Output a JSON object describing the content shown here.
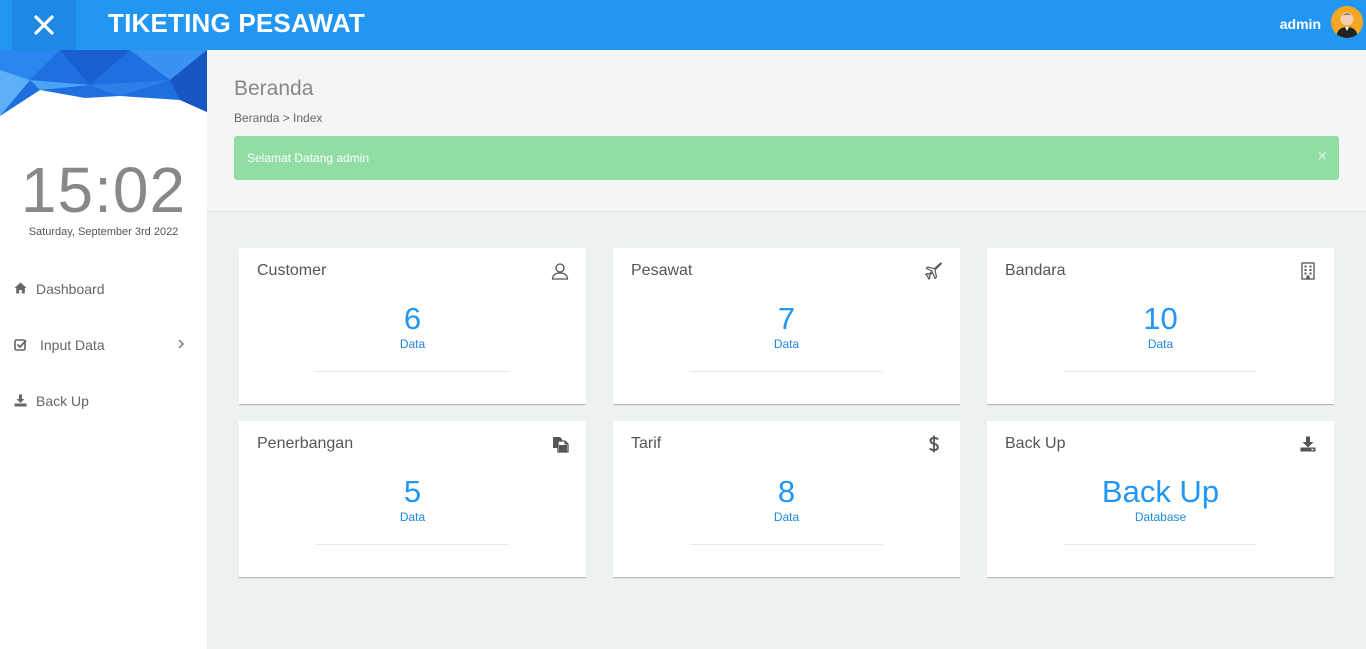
{
  "app": {
    "title": "TIKETING PESAWAT",
    "user": "admin"
  },
  "sidebar": {
    "time": "15:02",
    "date": "Saturday, September 3rd 2022",
    "items": [
      {
        "label": "Dashboard",
        "icon": "home-icon"
      },
      {
        "label": "Input Data",
        "icon": "check-square-icon",
        "has_submenu": true
      },
      {
        "label": "Back Up",
        "icon": "download-icon"
      }
    ]
  },
  "header": {
    "title": "Beranda",
    "breadcrumb": "Beranda > Index",
    "alert": "Selamat Datang admin",
    "alert_close": "×"
  },
  "cards": [
    {
      "title": "Customer",
      "value": "6",
      "unit": "Data",
      "icon": "user-icon"
    },
    {
      "title": "Pesawat",
      "value": "7",
      "unit": "Data",
      "icon": "plane-icon"
    },
    {
      "title": "Bandara",
      "value": "10",
      "unit": "Data",
      "icon": "building-icon"
    },
    {
      "title": "Penerbangan",
      "value": "5",
      "unit": "Data",
      "icon": "copy-icon"
    },
    {
      "title": "Tarif",
      "value": "8",
      "unit": "Data",
      "icon": "dollar-icon"
    },
    {
      "title": "Back Up",
      "value": "Back Up",
      "unit": "Database",
      "icon": "download-icon"
    }
  ],
  "colors": {
    "primary": "#2196f3",
    "alert": "#90dea3",
    "value": "#2196f3"
  }
}
